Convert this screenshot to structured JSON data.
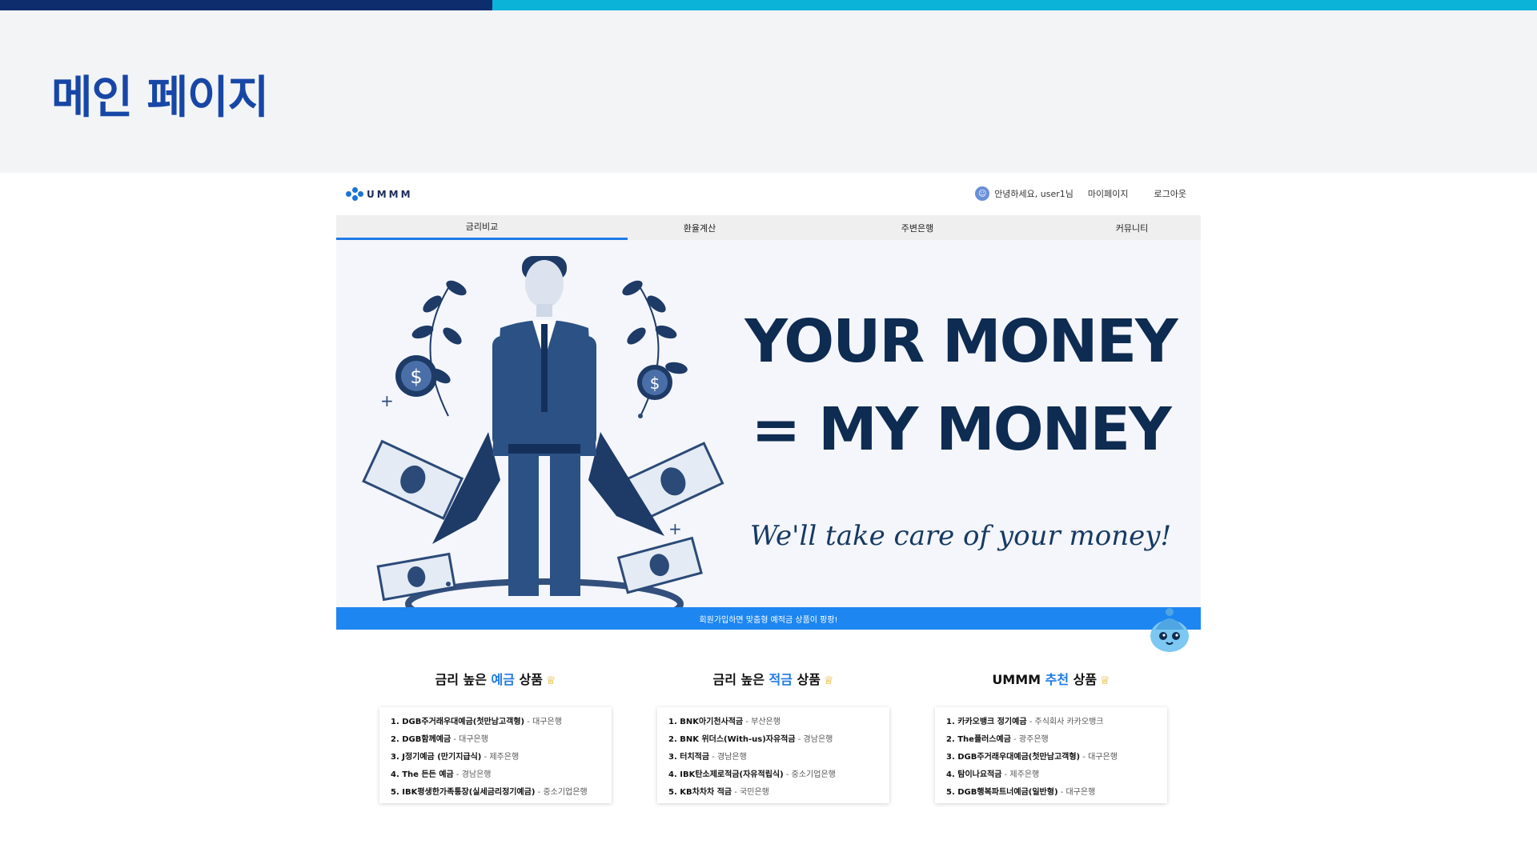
{
  "theme": {
    "bar_dark": "#0d2d6c",
    "bar_light": "#0bb3d9",
    "title_color": "#1747a6",
    "accent": "#1e7ae6",
    "banner_bg": "#1e86f0"
  },
  "slide": {
    "title": "메인 페이지"
  },
  "site": {
    "logo_text": "UMMM",
    "user": {
      "greeting": "안녕하세요, user1님",
      "mypage": "마이페이지",
      "logout": "로그아웃"
    },
    "nav": [
      {
        "label": "금리비교",
        "active": true
      },
      {
        "label": "환율계산",
        "active": false
      },
      {
        "label": "주변은행",
        "active": false
      },
      {
        "label": "커뮤니티",
        "active": false
      }
    ],
    "hero": {
      "line1": "YOUR MONEY",
      "line2": "= MY MONEY",
      "tagline": "We'll take care of your money!"
    },
    "banner_text": "회원가입하면 맞춤형 예적금 상품이 팡팡!",
    "products": [
      {
        "title_pre": "금리 높은 ",
        "title_accent": "예금",
        "title_post": " 상품",
        "items": [
          {
            "name": "1. DGB주거래우대예금(첫만남고객형)",
            "bank": " - 대구은행"
          },
          {
            "name": "2. DGB함께예금",
            "bank": " - 대구은행"
          },
          {
            "name": "3. J정기예금 (만기지급식)",
            "bank": " - 제주은행"
          },
          {
            "name": "4. The 든든 예금",
            "bank": " - 경남은행"
          },
          {
            "name": "5. IBK평생한가족통장(실세금리정기예금)",
            "bank": " - 중소기업은행"
          }
        ]
      },
      {
        "title_pre": "금리 높은 ",
        "title_accent": "적금",
        "title_post": " 상품",
        "items": [
          {
            "name": "1. BNK아기천사적금",
            "bank": " - 부산은행"
          },
          {
            "name": "2. BNK 위더스(With-us)자유적금",
            "bank": " - 경남은행"
          },
          {
            "name": "3. 터치적금",
            "bank": " - 경남은행"
          },
          {
            "name": "4. IBK탄소제로적금(자유적립식)",
            "bank": " - 중소기업은행"
          },
          {
            "name": "5. KB차차차 적금",
            "bank": " - 국민은행"
          }
        ]
      },
      {
        "title_pre": "UMMM ",
        "title_accent": "추천",
        "title_post": " 상품",
        "items": [
          {
            "name": "1. 카카오뱅크 정기예금",
            "bank": " - 주식회사 카카오뱅크"
          },
          {
            "name": "2. The플러스예금",
            "bank": " - 광주은행"
          },
          {
            "name": "3. DGB주거래우대예금(첫만남고객형)",
            "bank": " - 대구은행"
          },
          {
            "name": "4. 탐이나요적금",
            "bank": " - 제주은행"
          },
          {
            "name": "5. DGB행복파트너예금(일반형)",
            "bank": " - 대구은행"
          }
        ]
      }
    ],
    "icons": {
      "logo": "dots-logo-icon",
      "avatar": "user-avatar-icon",
      "trophy": "trophy-icon",
      "mascot": "mascot-icon"
    }
  }
}
